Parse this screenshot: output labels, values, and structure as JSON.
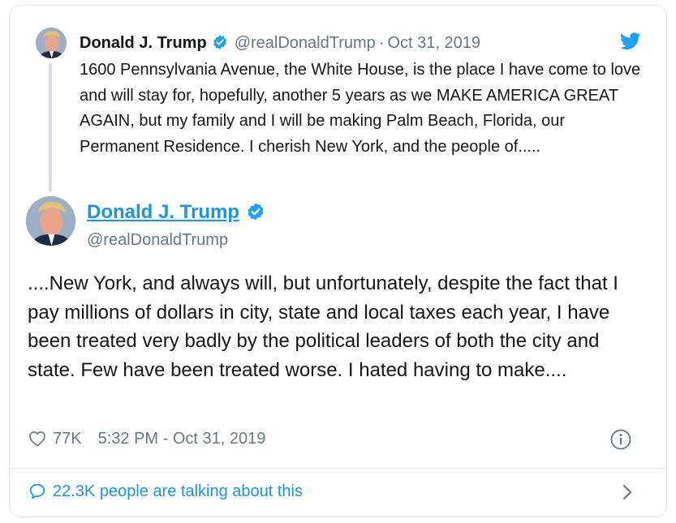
{
  "parent_tweet": {
    "name": "Donald J. Trump",
    "handle": "@realDonaldTrump",
    "separator": "·",
    "date": "Oct 31, 2019",
    "text": "1600 Pennsylvania Avenue, the White House, is the place I have come to love and will stay for, hopefully, another 5 years as we MAKE AMERICA GREAT AGAIN, but my family and I will be making Palm Beach, Florida, our Permanent Residence. I cherish New York, and the people of....."
  },
  "main_tweet": {
    "name": "Donald J. Trump",
    "handle": "@realDonaldTrump",
    "text": "....New York, and always will, but unfortunately, despite the fact that I pay millions of dollars in city, state and local taxes each year, I have been treated very badly by the political leaders of both the city and state. Few have been treated worse. I hated having to make....",
    "likes": "77K",
    "timestamp": "5:32 PM - Oct 31, 2019"
  },
  "footer": {
    "talking_text": "22.3K people are talking about this"
  },
  "icons": {
    "verified": "verified-badge-icon",
    "twitter_logo": "twitter-bird-icon",
    "like": "heart-icon",
    "info": "info-icon",
    "reply": "speech-bubble-icon",
    "chevron": "chevron-right-icon"
  },
  "colors": {
    "accent": "#1b95e0",
    "twitter_blue": "#1da1f2",
    "text": "#14171a",
    "secondary": "#657786",
    "border": "#e1e8ed"
  }
}
